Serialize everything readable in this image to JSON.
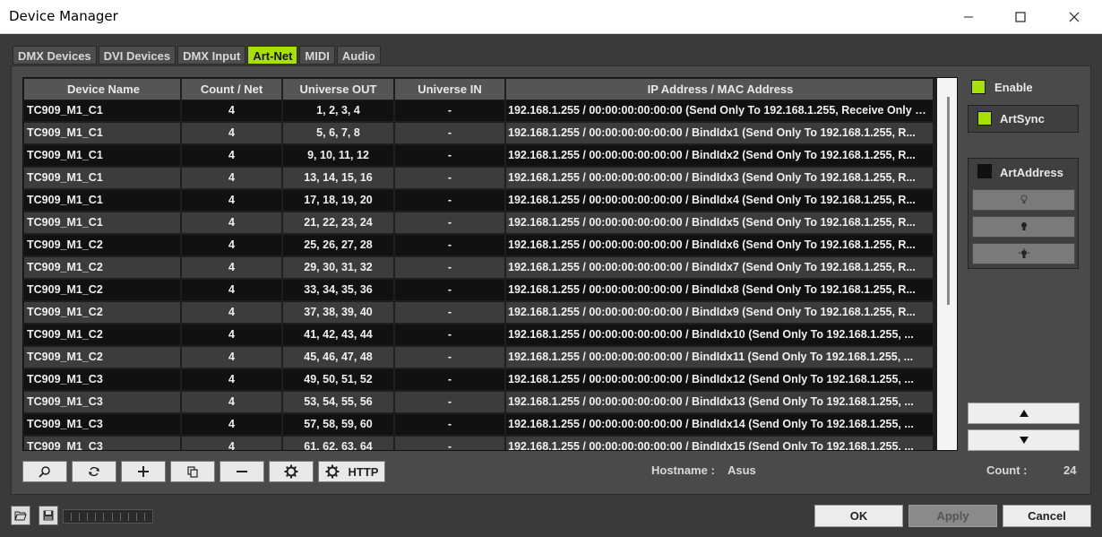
{
  "window": {
    "title": "Device Manager"
  },
  "tabs": [
    {
      "label": "DMX Devices",
      "active": false
    },
    {
      "label": "DVI Devices",
      "active": false
    },
    {
      "label": "DMX Input",
      "active": false
    },
    {
      "label": "Art-Net",
      "active": true
    },
    {
      "label": "MIDI",
      "active": false
    },
    {
      "label": "Audio",
      "active": false
    }
  ],
  "table": {
    "columns": [
      "Device Name",
      "Count / Net",
      "Universe OUT",
      "Universe IN",
      "IP Address / MAC Address"
    ],
    "rows": [
      [
        "TC909_M1_C1",
        "4",
        "1, 2, 3, 4",
        "-",
        "192.168.1.255 / 00:00:00:00:00:00 (Send Only To 192.168.1.255, Receive Only From..."
      ],
      [
        "TC909_M1_C1",
        "4",
        "5, 6, 7, 8",
        "-",
        "192.168.1.255 / 00:00:00:00:00:00 / BindIdx1 (Send Only To 192.168.1.255, R..."
      ],
      [
        "TC909_M1_C1",
        "4",
        "9, 10, 11, 12",
        "-",
        "192.168.1.255 / 00:00:00:00:00:00 / BindIdx2 (Send Only To 192.168.1.255, R..."
      ],
      [
        "TC909_M1_C1",
        "4",
        "13, 14, 15, 16",
        "-",
        "192.168.1.255 / 00:00:00:00:00:00 / BindIdx3 (Send Only To 192.168.1.255, R..."
      ],
      [
        "TC909_M1_C1",
        "4",
        "17, 18, 19, 20",
        "-",
        "192.168.1.255 / 00:00:00:00:00:00 / BindIdx4 (Send Only To 192.168.1.255, R..."
      ],
      [
        "TC909_M1_C1",
        "4",
        "21, 22, 23, 24",
        "-",
        "192.168.1.255 / 00:00:00:00:00:00 / BindIdx5 (Send Only To 192.168.1.255, R..."
      ],
      [
        "TC909_M1_C2",
        "4",
        "25, 26, 27, 28",
        "-",
        "192.168.1.255 / 00:00:00:00:00:00 / BindIdx6 (Send Only To 192.168.1.255, R..."
      ],
      [
        "TC909_M1_C2",
        "4",
        "29, 30, 31, 32",
        "-",
        "192.168.1.255 / 00:00:00:00:00:00 / BindIdx7 (Send Only To 192.168.1.255, R..."
      ],
      [
        "TC909_M1_C2",
        "4",
        "33, 34, 35, 36",
        "-",
        "192.168.1.255 / 00:00:00:00:00:00 / BindIdx8 (Send Only To 192.168.1.255, R..."
      ],
      [
        "TC909_M1_C2",
        "4",
        "37, 38, 39, 40",
        "-",
        "192.168.1.255 / 00:00:00:00:00:00 / BindIdx9 (Send Only To 192.168.1.255, R..."
      ],
      [
        "TC909_M1_C2",
        "4",
        "41, 42, 43, 44",
        "-",
        "192.168.1.255 / 00:00:00:00:00:00 / BindIdx10 (Send Only To 192.168.1.255, ..."
      ],
      [
        "TC909_M1_C2",
        "4",
        "45, 46, 47, 48",
        "-",
        "192.168.1.255 / 00:00:00:00:00:00 / BindIdx11 (Send Only To 192.168.1.255, ..."
      ],
      [
        "TC909_M1_C3",
        "4",
        "49, 50, 51, 52",
        "-",
        "192.168.1.255 / 00:00:00:00:00:00 / BindIdx12 (Send Only To 192.168.1.255, ..."
      ],
      [
        "TC909_M1_C3",
        "4",
        "53, 54, 55, 56",
        "-",
        "192.168.1.255 / 00:00:00:00:00:00 / BindIdx13 (Send Only To 192.168.1.255, ..."
      ],
      [
        "TC909_M1_C3",
        "4",
        "57, 58, 59, 60",
        "-",
        "192.168.1.255 / 00:00:00:00:00:00 / BindIdx14 (Send Only To 192.168.1.255, ..."
      ],
      [
        "TC909_M1_C3",
        "4",
        "61, 62, 63, 64",
        "-",
        "192.168.1.255 / 00:00:00:00:00:00 / BindIdx15 (Send Only To 192.168.1.255, ..."
      ]
    ]
  },
  "side": {
    "enable_label": "Enable",
    "enable_checked": true,
    "artsync_label": "ArtSync",
    "artsync_checked": true,
    "artaddress_label": "ArtAddress",
    "artaddress_checked": false
  },
  "toolbar": {
    "http_label": "HTTP",
    "hostname_label": "Hostname :",
    "hostname_value": "Asus",
    "count_label": "Count :",
    "count_value": "24"
  },
  "footer": {
    "ok_label": "OK",
    "apply_label": "Apply",
    "cancel_label": "Cancel"
  },
  "colors": {
    "accent": "#a8e000",
    "panel": "#4a4a4a",
    "row_dark": "#111111",
    "row_light": "#3c3c3c"
  }
}
